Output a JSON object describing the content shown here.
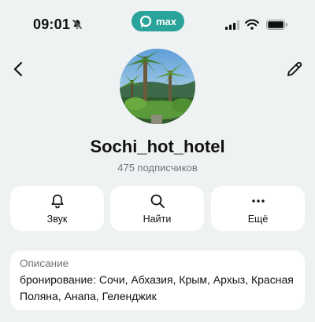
{
  "status_bar": {
    "time": "09:01",
    "app_pill_label": "max",
    "brand_color": "#2aa39a",
    "icons": [
      "bell-slash-icon",
      "signal-icon",
      "wifi-icon",
      "battery-icon"
    ]
  },
  "header": {
    "back_icon": "chevron-left-icon",
    "edit_icon": "pencil-icon"
  },
  "profile": {
    "name": "Sochi_hot_hotel",
    "subscribers": "475 подписчиков"
  },
  "actions": [
    {
      "label": "Звук",
      "icon": "bell-icon"
    },
    {
      "label": "Найти",
      "icon": "search-icon"
    },
    {
      "label": "Ещё",
      "icon": "more-icon"
    }
  ],
  "description": {
    "title": "Описание",
    "text": "бронирование: Сочи, Абхазия, Крым, Архыз, Красная Поляна, Анапа, Геленджик"
  }
}
